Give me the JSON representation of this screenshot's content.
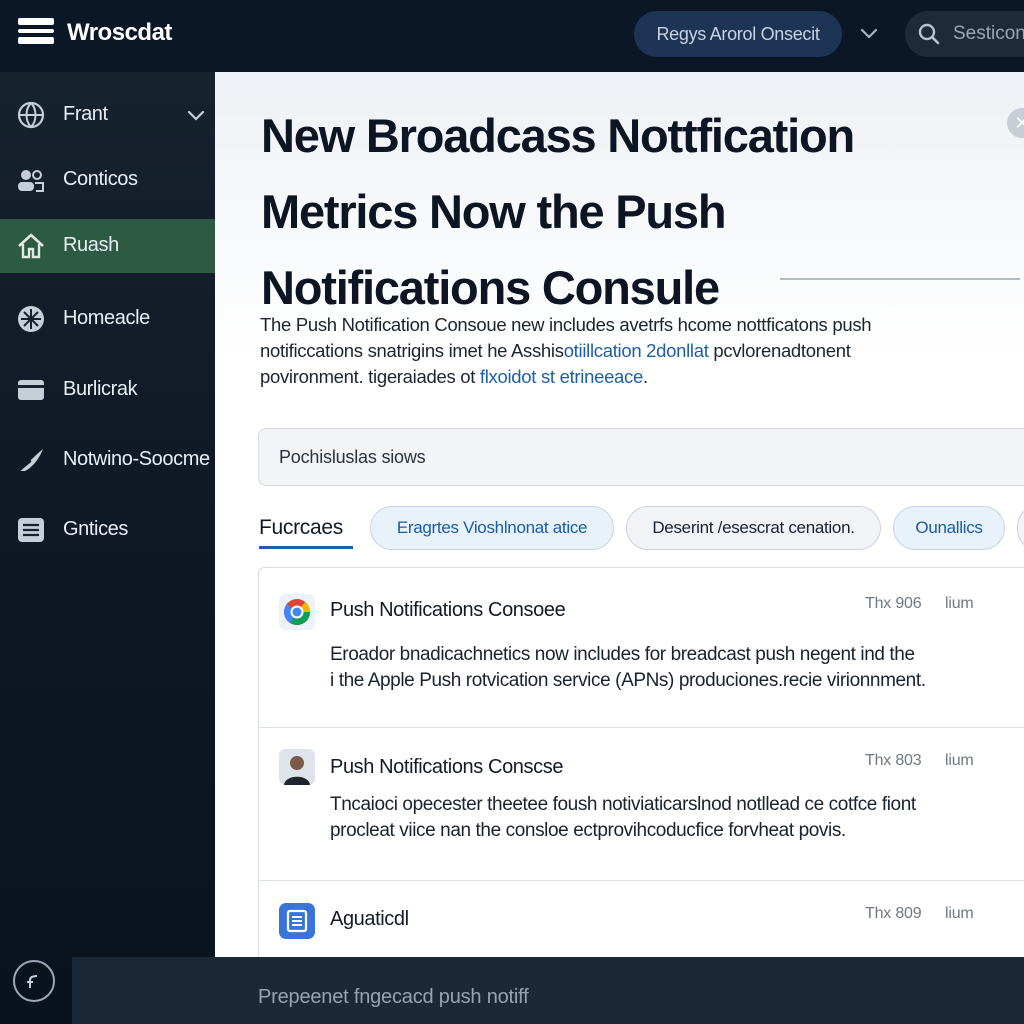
{
  "app": {
    "title": "Wroscdat",
    "menu_icon": "hamburger-menu-icon"
  },
  "topbar": {
    "region_label": "Regys Arorol Onsecit",
    "search_placeholder": "Sesticon"
  },
  "sidebar": {
    "items": [
      {
        "label": "Frant",
        "icon": "globe-icon",
        "active": false,
        "expandable": true
      },
      {
        "label": "Conticos",
        "icon": "contacts-icon",
        "active": false
      },
      {
        "label": "Ruash",
        "icon": "home-icon",
        "active": true
      },
      {
        "label": "Homeacle",
        "icon": "dashboard-icon",
        "active": false
      },
      {
        "label": "Burlicrak",
        "icon": "card-icon",
        "active": false
      },
      {
        "label": "Notwino-Soocme",
        "icon": "send-icon",
        "active": false
      },
      {
        "label": "Gntices",
        "icon": "document-icon",
        "active": false
      }
    ],
    "help_icon": "help-icon"
  },
  "main": {
    "headline_lines": [
      "New Broadcass Nottfication",
      "Metrics Now the Push",
      "Notifications Consule"
    ],
    "intro": {
      "line1": "The Push Notification Consoue new includes avetrfs hcome nottficatons push",
      "line2_a": "notificcations snatrigins imet he Asshis",
      "line2_link": "otiillcation 2donllat",
      "line2_b": " pcvlorenadtonent",
      "line3_a": "povironment. tigeraiades ot ",
      "line3_link": "flxoidot st etrineeace",
      "line3_b": "."
    },
    "filter_placeholder": "Pochisluslas siows",
    "tabs": {
      "active": "Fucrcaes",
      "chips": [
        "Eragrtes Vioshlnonat atice",
        "Deserint /esescrat cenation.",
        "Ounallics",
        ""
      ]
    },
    "feed": [
      {
        "icon": "chrome-logo-icon",
        "title": "Push Notifications Consoee",
        "time": "Thx 906",
        "unit": "lium",
        "body": [
          "Eroador bnadicachnetics now includes for breadcast push negent ind the",
          "i the Apple Push rotvication service (APNs) produciones.recie virionnment."
        ]
      },
      {
        "icon": "person-avatar-icon",
        "title": "Push Notifications Conscse",
        "time": "Thx 803",
        "unit": "lium",
        "body": [
          "Tncaioci opecester theetee foush notiviaticarslnod notllead ce cotfce fiont",
          "procleat viice nan the consloe ectprovihcoducfice forvheat povis."
        ]
      },
      {
        "icon": "docs-icon",
        "title": "Aguaticdl",
        "time": "Thx 809",
        "unit": "lium",
        "body": []
      }
    ]
  },
  "composer": {
    "placeholder": "Prepeenet fngecacd push notiff"
  },
  "colors": {
    "topbar_bg": "#0b1626",
    "sidebar_active": "#2c5a42",
    "accent_blue": "#1d5fa6",
    "composer_bg": "#1b2838"
  }
}
